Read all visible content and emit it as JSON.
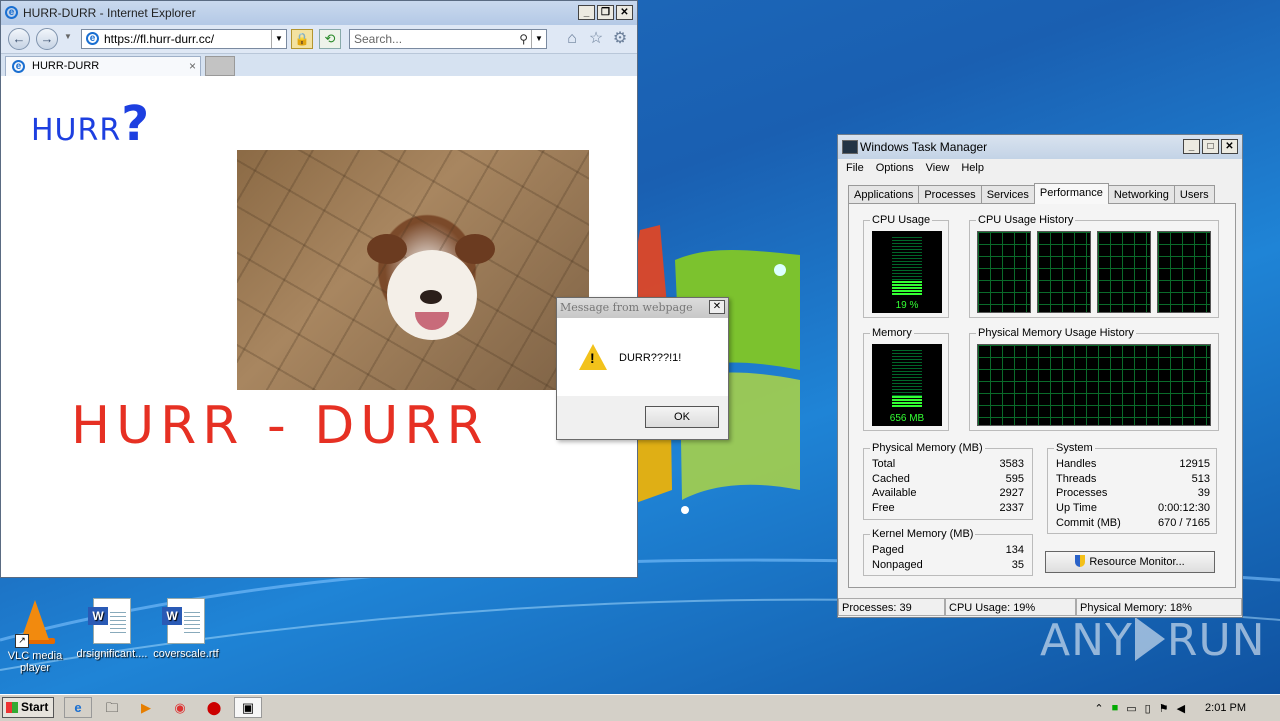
{
  "ie": {
    "title": "HURR-DURR - Internet Explorer",
    "address": "https://fl.hurr-durr.cc/",
    "search_placeholder": "Search...",
    "tab_label": "HURR-DURR",
    "page": {
      "heading_small": "HURR",
      "heading_small_mark": "?",
      "heading_big": "HURR - DURR"
    }
  },
  "dialog": {
    "title": "Message from webpage",
    "message": "DURR???!1!",
    "ok_label": "OK"
  },
  "taskmgr": {
    "title": "Windows Task Manager",
    "menu": [
      "File",
      "Options",
      "View",
      "Help"
    ],
    "tabs": [
      "Applications",
      "Processes",
      "Services",
      "Performance",
      "Networking",
      "Users"
    ],
    "active_tab": "Performance",
    "cpu_usage_label": "CPU Usage",
    "cpu_usage_value": "19 %",
    "cpu_history_label": "CPU Usage History",
    "memory_label": "Memory",
    "memory_value": "656 MB",
    "phys_history_label": "Physical Memory Usage History",
    "physical_memory": {
      "label": "Physical Memory (MB)",
      "rows": [
        {
          "k": "Total",
          "v": "3583"
        },
        {
          "k": "Cached",
          "v": "595"
        },
        {
          "k": "Available",
          "v": "2927"
        },
        {
          "k": "Free",
          "v": "2337"
        }
      ]
    },
    "system": {
      "label": "System",
      "rows": [
        {
          "k": "Handles",
          "v": "12915"
        },
        {
          "k": "Threads",
          "v": "513"
        },
        {
          "k": "Processes",
          "v": "39"
        },
        {
          "k": "Up Time",
          "v": "0:00:12:30"
        },
        {
          "k": "Commit (MB)",
          "v": "670 / 7165"
        }
      ]
    },
    "kernel_memory": {
      "label": "Kernel Memory (MB)",
      "rows": [
        {
          "k": "Paged",
          "v": "134"
        },
        {
          "k": "Nonpaged",
          "v": "35"
        }
      ]
    },
    "resource_monitor_label": "Resource Monitor...",
    "status": {
      "processes": "Processes: 39",
      "cpu": "CPU Usage: 19%",
      "memory": "Physical Memory: 18%"
    }
  },
  "desktop_icons": [
    {
      "label": "VLC media player",
      "icon": "vlc-icon"
    },
    {
      "label": "drsignificant....",
      "icon": "word-doc-icon"
    },
    {
      "label": "coverscale.rtf",
      "icon": "word-doc-icon"
    }
  ],
  "taskbar": {
    "start_label": "Start",
    "clock": "2:01 PM"
  },
  "watermark": {
    "left": "ANY",
    "right": "RUN"
  }
}
